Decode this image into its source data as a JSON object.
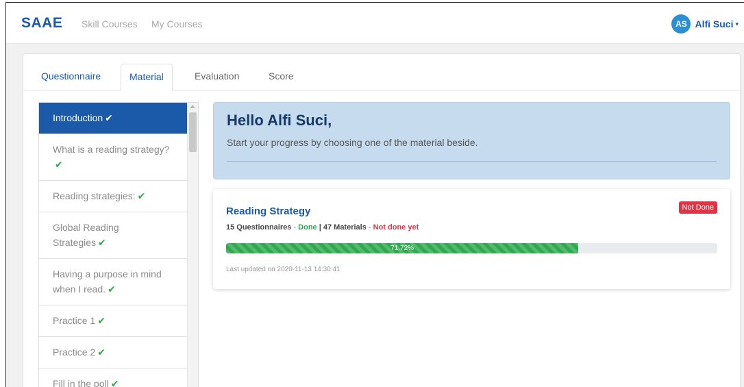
{
  "navbar": {
    "brand": "SAAE",
    "links": [
      "Skill Courses",
      "My Courses"
    ],
    "user": {
      "initials": "AS",
      "name": "Alfi Suci",
      "caret": "▾"
    }
  },
  "tabs": [
    {
      "label": "Questionnaire"
    },
    {
      "label": "Material",
      "active": true
    },
    {
      "label": "Evaluation"
    },
    {
      "label": "Score"
    }
  ],
  "sidebar": {
    "items": [
      {
        "label": "Introduction",
        "check": "✔",
        "active": true
      },
      {
        "label": "What is a reading strategy?",
        "check": "✔"
      },
      {
        "label": "Reading strategies:",
        "check": "✔"
      },
      {
        "label": "Global Reading Strategies",
        "check": "✔"
      },
      {
        "label": "Having a purpose in mind when I read.",
        "check": "✔"
      },
      {
        "label": "Practice 1",
        "check": "✔"
      },
      {
        "label": "Practice 2",
        "check": "✔"
      },
      {
        "label": "Fill in the poll",
        "check": "✔"
      }
    ]
  },
  "hello": {
    "title": "Hello Alfi Suci,",
    "subtitle": "Start your progress by choosing one of the material beside."
  },
  "course": {
    "title": "Reading Strategy",
    "badge": "Not Done",
    "questionnaires": "15 Questionnaires",
    "sep1": " - ",
    "questionnaires_status": "Done",
    "pipe": " | ",
    "materials": "47 Materials",
    "sep2": " - ",
    "materials_status": "Not done yet",
    "progress_label": "71.72%",
    "progress_percent": 71.72,
    "updated": "Last updated on 2020-11-13 14:30:41"
  },
  "colors": {
    "brand": "#1a5aa8",
    "success": "#2fa84f",
    "danger": "#dc3545",
    "hello_bg": "#c6dcee"
  }
}
